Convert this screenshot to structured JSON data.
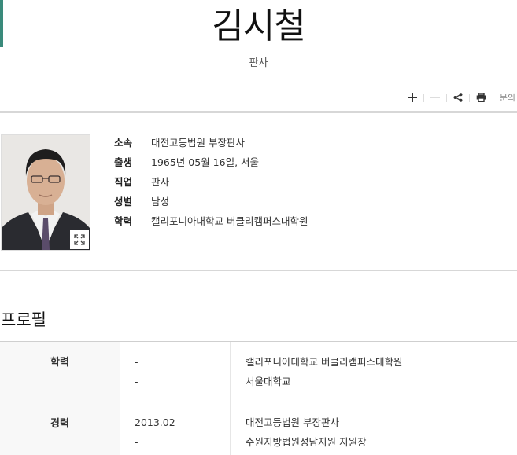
{
  "header": {
    "name": "김시철",
    "title": "판사"
  },
  "toolbar": {
    "zoom_in_icon": "plus-icon",
    "zoom_out_icon": "minus-icon",
    "share_icon": "share-icon",
    "print_icon": "print-icon",
    "inquiry_label": "문의"
  },
  "photo": {
    "expand_icon": "expand-icon"
  },
  "info": [
    {
      "label": "소속",
      "value": "대전고등법원 부장판사"
    },
    {
      "label": "출생",
      "value": "1965년 05월 16일, 서울"
    },
    {
      "label": "직업",
      "value": "판사"
    },
    {
      "label": "성별",
      "value": "남성"
    },
    {
      "label": "학력",
      "value": "캘리포니아대학교 버클리캠퍼스대학원"
    }
  ],
  "profile": {
    "section_title": "프로필",
    "rows": [
      {
        "category": "학력",
        "entries": [
          {
            "date": "-",
            "desc": "캘리포니아대학교 버클리캠퍼스대학원"
          },
          {
            "date": "-",
            "desc": "서울대학교"
          }
        ]
      },
      {
        "category": "경력",
        "entries": [
          {
            "date": "2013.02",
            "desc": "대전고등법원 부장판사"
          },
          {
            "date": "-",
            "desc": "수원지방법원성남지원 지원장"
          }
        ]
      }
    ]
  }
}
